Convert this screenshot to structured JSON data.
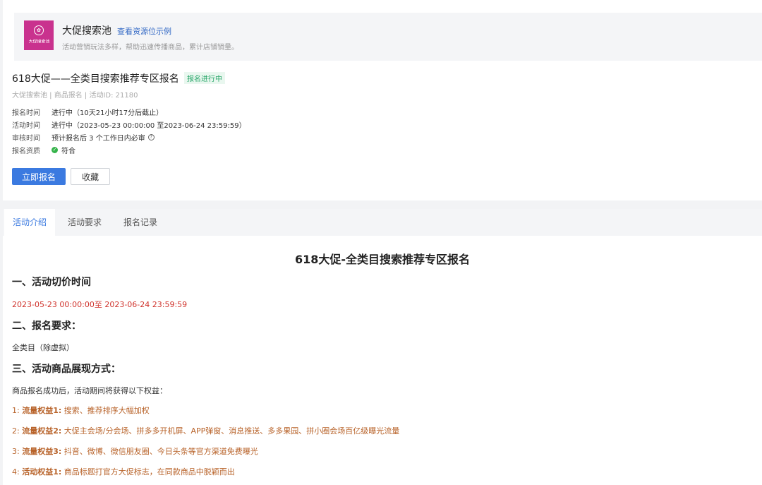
{
  "pool": {
    "logo_text": "大促搜索池",
    "title": "大促搜索池",
    "link": "查看资源位示例",
    "desc": "活动营销玩法多样，帮助迅速传播商品，累计店铺销量。"
  },
  "activity": {
    "title": "618大促——全类目搜索推荐专区报名",
    "badge": "报名进行中",
    "meta": "大促搜索池 | 商品报名 | 活动ID: 21180",
    "info": [
      {
        "key": "报名时间",
        "value": "进行中（10天21小时17分后截止）"
      },
      {
        "key": "活动时间",
        "value": "进行中（2023-05-23 00:00:00 至2023-06-24 23:59:59）"
      },
      {
        "key": "审核时间",
        "value": "预计报名后 3 个工作日内必审"
      },
      {
        "key": "报名资质",
        "value": "符合"
      }
    ],
    "apply_label": "立即报名",
    "favorite_label": "收藏"
  },
  "tabs": [
    {
      "label": "活动介绍"
    },
    {
      "label": "活动要求"
    },
    {
      "label": "报名记录"
    }
  ],
  "content": {
    "title": "618大促-全类目搜索推荐专区报名",
    "h1": "一、活动切价时间",
    "time_range": "2023-05-23 00:00:00至 2023-06-24 23:59:59",
    "h2": "二、报名要求：",
    "requirement": "全类目（除虚拟）",
    "h3": "三、活动商品展现方式：",
    "intro": "商品报名成功后，活动期间将获得以下权益：",
    "benefits": [
      {
        "num": "1:",
        "name": "流量权益1:",
        "text": "搜索、推荐排序大幅加权"
      },
      {
        "num": "2:",
        "name": "流量权益2:",
        "text": "大促主会场/分会场、拼多多开机屏、APP弹窗、消息推送、多多果园、拼小圈会场百亿级曝光流量"
      },
      {
        "num": "3:",
        "name": "流量权益3:",
        "text": "抖音、微博、微信朋友圈、今日头条等官方渠道免费曝光"
      },
      {
        "num": "4:",
        "name": "活动权益1:",
        "text": "商品标题打官方大促标志，在同款商品中脱颖而出"
      }
    ]
  },
  "colors": {
    "primary": "#3b7ae0",
    "badge_green": "#2ca86c",
    "red_text": "#d0332c",
    "brown_text": "#b8632a",
    "logo_bg": "#c9328e"
  }
}
